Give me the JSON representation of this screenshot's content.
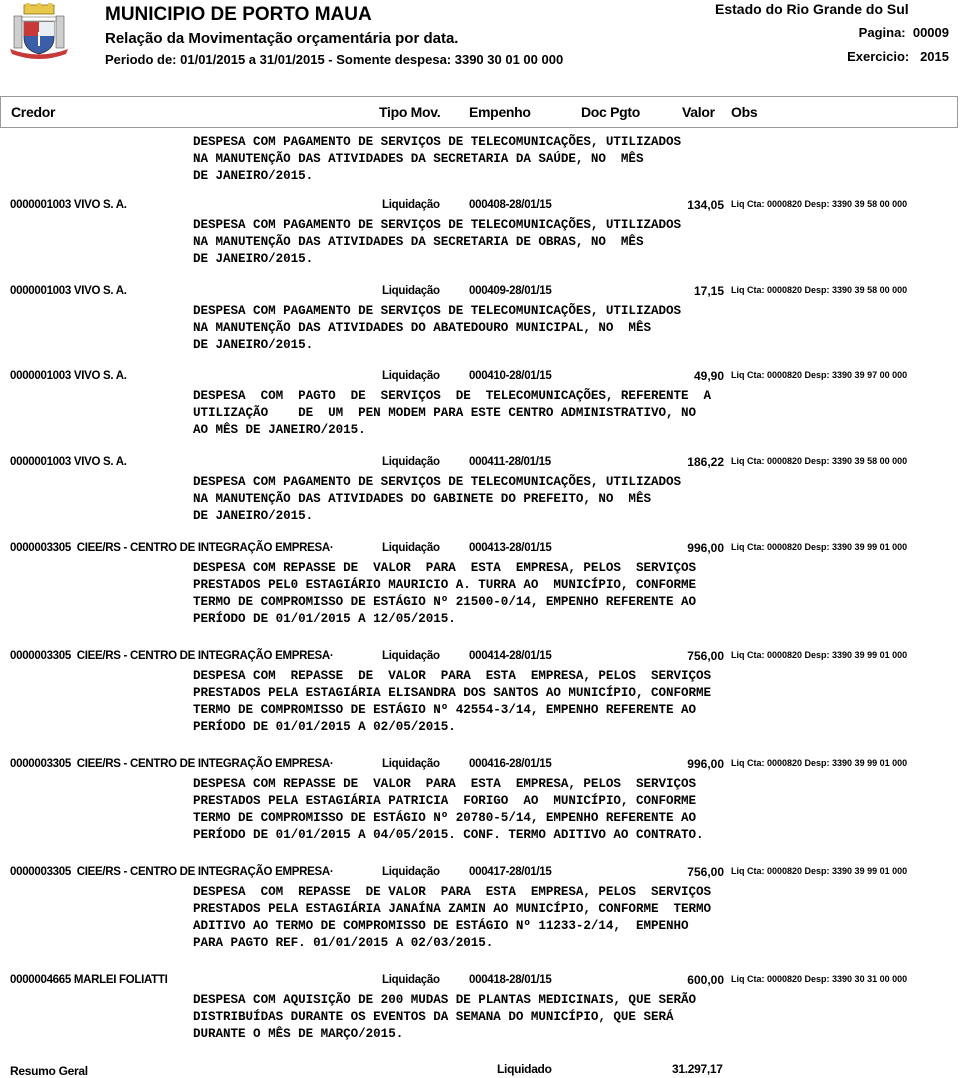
{
  "header": {
    "logo_icon": "municipal-coat-of-arms",
    "title": "MUNICIPIO DE PORTO MAUA",
    "subtitle": "Relação da Movimentação orçamentária por data.",
    "period": "Periodo de: 01/01/2015 a 31/01/2015 - Somente despesa: 3390 30 01 00 000",
    "state": "Estado do Rio Grande do Sul",
    "page": "Pagina:  00009",
    "exercise": "Exercicio:   2015"
  },
  "columns": {
    "credor": "Credor",
    "tipo_mov": "Tipo Mov.",
    "empenho": "Empenho",
    "doc_pgto": "Doc Pgto",
    "valor": "Valor",
    "obs": "Obs"
  },
  "carryover_description": "DESPESA COM PAGAMENTO DE SERVIÇOS DE TELECOMUNICAÇÕES, UTILIZADOS\nNA MANUTENÇÃO DAS ATIVIDADES DA SECRETARIA DA SAÚDE, NO  MÊS\nDE JANEIRO/2015.",
  "entries": [
    {
      "credor": "0000001003 VIVO S. A.",
      "tipo": "Liquidação",
      "empenho": "000408-28/01/15",
      "valor": "134,05",
      "obs": "Liq Cta: 0000820 Desp: 3390 39 58 00 000",
      "descricao": "DESPESA COM PAGAMENTO DE SERVIÇOS DE TELECOMUNICAÇÕES, UTILIZADOS\nNA MANUTENÇÃO DAS ATIVIDADES DA SECRETARIA DE OBRAS, NO  MÊS\nDE JANEIRO/2015."
    },
    {
      "credor": "0000001003 VIVO S. A.",
      "tipo": "Liquidação",
      "empenho": "000409-28/01/15",
      "valor": "17,15",
      "obs": "Liq Cta: 0000820 Desp: 3390 39 58 00 000",
      "descricao": "DESPESA COM PAGAMENTO DE SERVIÇOS DE TELECOMUNICAÇÕES, UTILIZADOS\nNA MANUTENÇÃO DAS ATIVIDADES DO ABATEDOURO MUNICIPAL, NO  MÊS\nDE JANEIRO/2015."
    },
    {
      "credor": "0000001003 VIVO S. A.",
      "tipo": "Liquidação",
      "empenho": "000410-28/01/15",
      "valor": "49,90",
      "obs": "Liq Cta: 0000820 Desp: 3390 39 97 00 000",
      "descricao": "DESPESA  COM  PAGTO  DE  SERVIÇOS  DE  TELECOMUNICAÇÕES, REFERENTE  A\nUTILIZAÇÃO    DE  UM  PEN MODEM PARA ESTE CENTRO ADMINISTRATIVO, NO\nAO MÊS DE JANEIRO/2015."
    },
    {
      "credor": "0000001003 VIVO S. A.",
      "tipo": "Liquidação",
      "empenho": "000411-28/01/15",
      "valor": "186,22",
      "obs": "Liq Cta: 0000820 Desp: 3390 39 58 00 000",
      "descricao": "DESPESA COM PAGAMENTO DE SERVIÇOS DE TELECOMUNICAÇÕES, UTILIZADOS\nNA MANUTENÇÃO DAS ATIVIDADES DO GABINETE DO PREFEITO, NO  MÊS\nDE JANEIRO/2015."
    },
    {
      "credor": "0000003305  CIEE/RS - CENTRO DE INTEGRAÇÃO EMPRESA·",
      "tipo": "Liquidação",
      "empenho": "000413-28/01/15",
      "valor": "996,00",
      "obs": "Liq Cta: 0000820 Desp: 3390 39 99 01 000",
      "descricao": "DESPESA COM REPASSE DE  VALOR  PARA  ESTA  EMPRESA, PELOS  SERVIÇOS\nPRESTADOS PEL0 ESTAGIÁRIO MAURICIO A. TURRA AO  MUNICÍPIO, CONFORME\nTERMO DE COMPROMISSO DE ESTÁGIO Nº 21500-0/14, EMPENHO REFERENTE AO\nPERÍODO DE 01/01/2015 A 12/05/2015."
    },
    {
      "credor": "0000003305  CIEE/RS - CENTRO DE INTEGRAÇÃO EMPRESA·",
      "tipo": "Liquidação",
      "empenho": "000414-28/01/15",
      "valor": "756,00",
      "obs": "Liq Cta: 0000820 Desp: 3390 39 99 01 000",
      "descricao": "DESPESA COM  REPASSE  DE  VALOR  PARA  ESTA  EMPRESA, PELOS  SERVIÇOS\nPRESTADOS PELA ESTAGIÁRIA ELISANDRA DOS SANTOS AO MUNICÍPIO, CONFORME\nTERMO DE COMPROMISSO DE ESTÁGIO Nº 42554-3/14, EMPENHO REFERENTE AO\nPERÍODO DE 01/01/2015 A 02/05/2015."
    },
    {
      "credor": "0000003305  CIEE/RS - CENTRO DE INTEGRAÇÃO EMPRESA·",
      "tipo": "Liquidação",
      "empenho": "000416-28/01/15",
      "valor": "996,00",
      "obs": "Liq Cta: 0000820 Desp: 3390 39 99 01 000",
      "descricao": "DESPESA COM REPASSE DE  VALOR  PARA  ESTA  EMPRESA, PELOS  SERVIÇOS\nPRESTADOS PELA ESTAGIÁRIA PATRICIA  FORIGO  AO  MUNICÍPIO, CONFORME\nTERMO DE COMPROMISSO DE ESTÁGIO Nº 20780-5/14, EMPENHO REFERENTE AO\nPERÍODO DE 01/01/2015 A 04/05/2015. CONF. TERMO ADITIVO AO CONTRATO."
    },
    {
      "credor": "0000003305  CIEE/RS - CENTRO DE INTEGRAÇÃO EMPRESA·",
      "tipo": "Liquidação",
      "empenho": "000417-28/01/15",
      "valor": "756,00",
      "obs": "Liq Cta: 0000820 Desp: 3390 39 99 01 000",
      "descricao": "DESPESA  COM  REPASSE  DE VALOR  PARA  ESTA  EMPRESA, PELOS  SERVIÇOS\nPRESTADOS PELA ESTAGIÁRIA JANAÍNA ZAMIN AO MUNICÍPIO, CONFORME  TERMO\nADITIVO AO TERMO DE COMPROMISSO DE ESTÁGIO Nº 11233-2/14,  EMPENHO\nPARA PAGTO REF. 01/01/2015 A 02/03/2015."
    },
    {
      "credor": "0000004665 MARLEI FOLIATTI",
      "tipo": "Liquidação",
      "empenho": "000418-28/01/15",
      "valor": "600,00",
      "obs": "Liq Cta: 0000820 Desp: 3390 30 31 00 000",
      "descricao": "DESPESA COM AQUISIÇÃO DE 200 MUDAS DE PLANTAS MEDICINAIS, QUE SERÃO\nDISTRIBUÍDAS DURANTE OS EVENTOS DA SEMANA DO MUNICÍPIO, QUE SERÁ\nDURANTE O MÊS DE MARÇO/2015."
    }
  ],
  "summary": {
    "label": "Resumo Geral",
    "type": "Liquidado",
    "total": "31.297,17"
  }
}
